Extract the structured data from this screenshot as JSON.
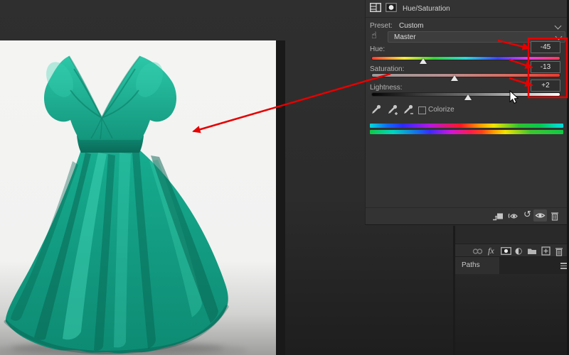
{
  "properties_panel": {
    "title": "Hue/Saturation",
    "preset": {
      "label": "Preset:",
      "value": "Custom"
    },
    "channel": {
      "value": "Master"
    },
    "sliders": {
      "hue": {
        "label": "Hue:",
        "value": "-45",
        "thumb_pct": 27.2
      },
      "saturation": {
        "label": "Saturation:",
        "value": "-13",
        "thumb_pct": 43.8
      },
      "lightness": {
        "label": "Lightness:",
        "value": "+2",
        "thumb_pct": 51.0
      }
    },
    "colorize": {
      "label": "Colorize",
      "checked": false
    }
  },
  "layers_bar": {
    "fx_label": "fx"
  },
  "paths_panel": {
    "tab_label": "Paths"
  },
  "icons": {
    "on_image_adjust_glyph": "☝",
    "reset_glyph": "↺",
    "adjustment_glyph": "◐"
  },
  "annotation": {
    "accent": "#e60000",
    "highlighted_values": [
      "-45",
      "-13",
      "+2"
    ]
  },
  "colors": {
    "panel_bg": "#333333",
    "canvas_bg": "#f3f3f2",
    "dress_teal": "#14a78c",
    "annotation_red": "#e60000"
  }
}
